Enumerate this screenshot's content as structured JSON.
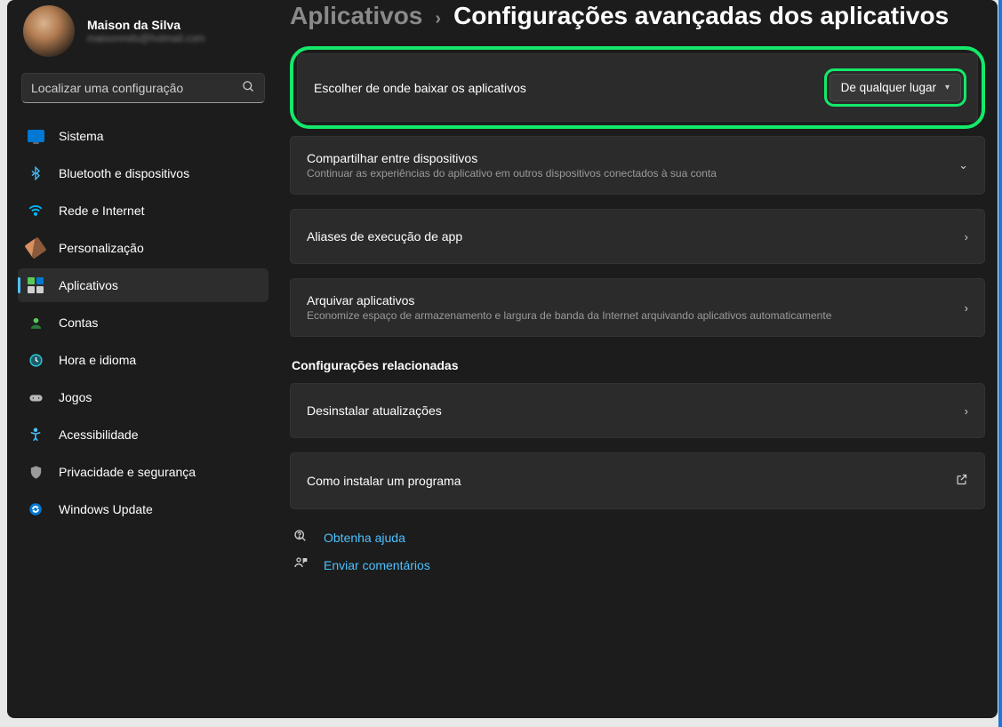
{
  "profile": {
    "name": "Maison da Silva",
    "email": "maisonmds@hotmail.com"
  },
  "search": {
    "placeholder": "Localizar uma configuração"
  },
  "nav": {
    "system": "Sistema",
    "bluetooth": "Bluetooth e dispositivos",
    "network": "Rede e Internet",
    "personalization": "Personalização",
    "apps": "Aplicativos",
    "accounts": "Contas",
    "time": "Hora e idioma",
    "gaming": "Jogos",
    "accessibility": "Acessibilidade",
    "privacy": "Privacidade e segurança",
    "update": "Windows Update"
  },
  "breadcrumb": {
    "parent": "Aplicativos",
    "sep": "›",
    "current": "Configurações avançadas dos aplicativos"
  },
  "cards": {
    "choose": {
      "title": "Escolher de onde baixar os aplicativos",
      "dropdown": "De qualquer lugar"
    },
    "share": {
      "title": "Compartilhar entre dispositivos",
      "sub": "Continuar as experiências do aplicativo em outros dispositivos conectados à sua conta"
    },
    "alias": {
      "title": "Aliases de execução de app"
    },
    "archive": {
      "title": "Arquivar aplicativos",
      "sub": "Economize espaço de armazenamento e largura de banda da Internet arquivando aplicativos automaticamente"
    },
    "related_heading": "Configurações relacionadas",
    "uninstall": {
      "title": "Desinstalar atualizações"
    },
    "howto": {
      "title": "Como instalar um programa"
    }
  },
  "footer": {
    "help": "Obtenha ajuda",
    "feedback": "Enviar comentários"
  }
}
